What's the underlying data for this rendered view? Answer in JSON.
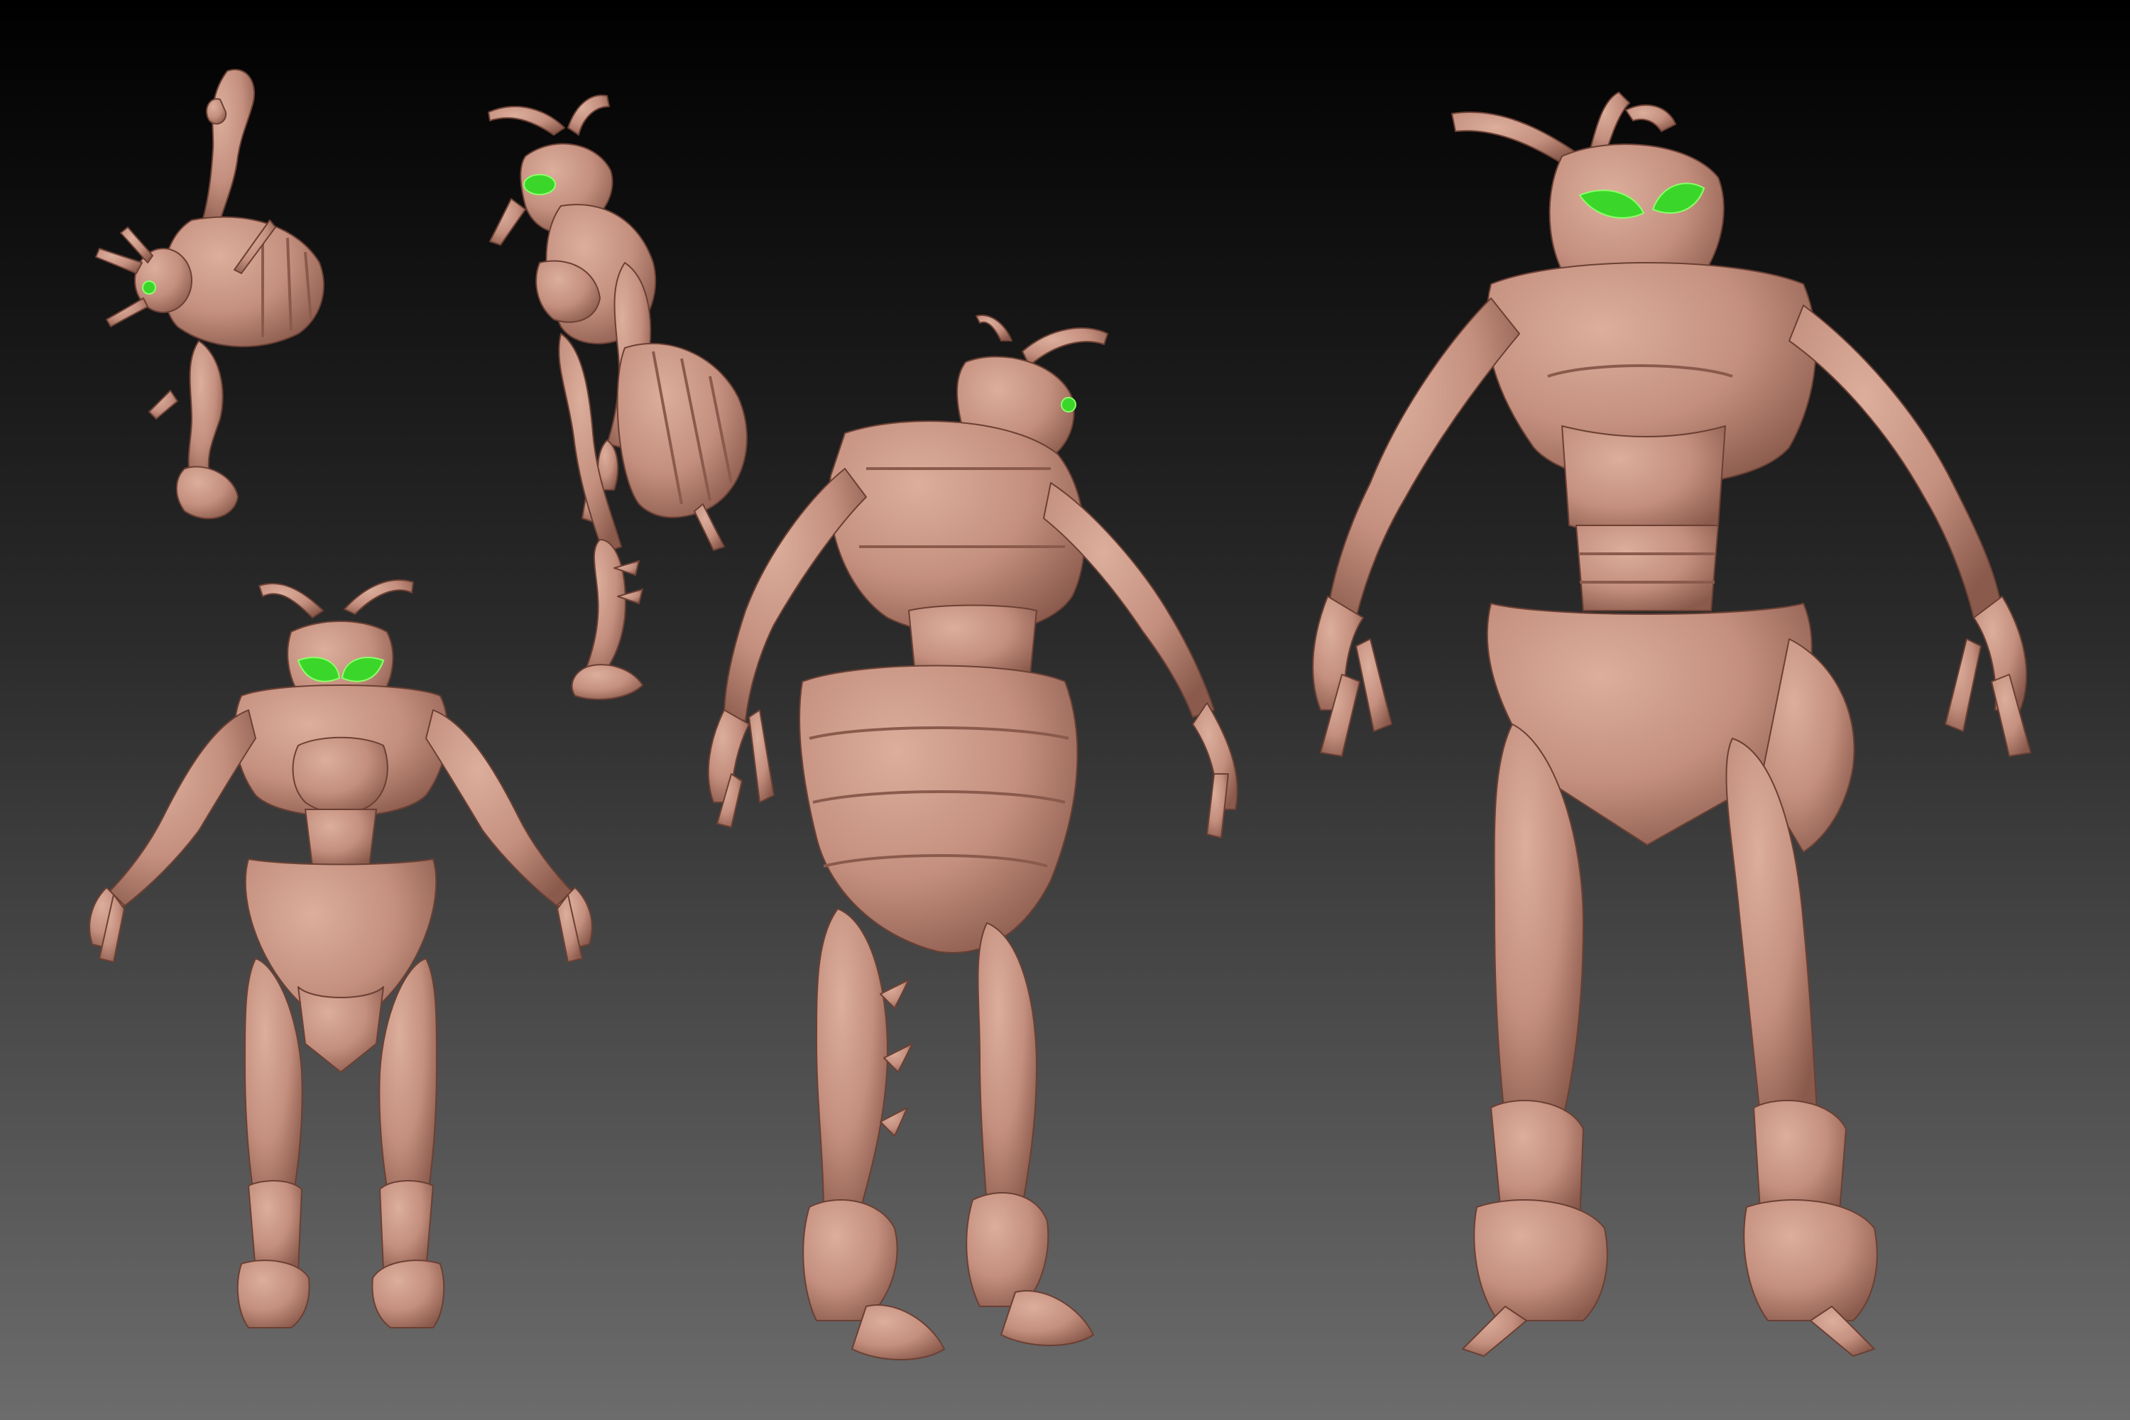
{
  "scene": {
    "description_free": true,
    "background": {
      "top_color": "#000000",
      "mid_color": "#2b2b2b",
      "bottom_color": "#6c6c6c"
    },
    "colors": {
      "clay": "#c48f7e",
      "clay_light": "#dcae9c",
      "clay_shadow": "#8a5a4c",
      "clay_dark": "#6b4034",
      "eye_green": "#3bd62a",
      "eye_green_light": "#8cff6a"
    },
    "views": [
      {
        "id": "top-view",
        "pose": "top"
      },
      {
        "id": "side-view",
        "pose": "side"
      },
      {
        "id": "front-view-small",
        "pose": "front"
      },
      {
        "id": "back-three-quarter-view",
        "pose": "back"
      },
      {
        "id": "front-three-quarter-view",
        "pose": "front-large"
      }
    ]
  }
}
